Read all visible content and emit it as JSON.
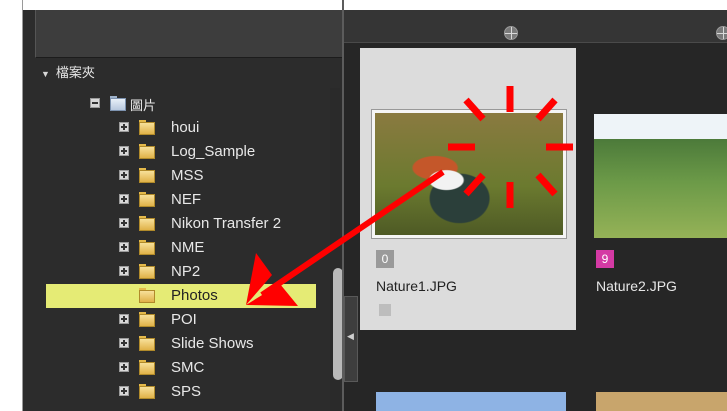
{
  "folder_panel": {
    "section_title": "檔案夾",
    "root_label": "圖片",
    "items": [
      {
        "label": "houi",
        "expander": "plus"
      },
      {
        "label": "Log_Sample",
        "expander": "plus"
      },
      {
        "label": "MSS",
        "expander": "plus"
      },
      {
        "label": "NEF",
        "expander": "plus"
      },
      {
        "label": "Nikon Transfer 2",
        "expander": "plus"
      },
      {
        "label": "NME",
        "expander": "plus"
      },
      {
        "label": "NP2",
        "expander": "plus"
      },
      {
        "label": "Photos",
        "expander": "none",
        "selected": true
      },
      {
        "label": "POI",
        "expander": "plus"
      },
      {
        "label": "Slide Shows",
        "expander": "plus"
      },
      {
        "label": "SMC",
        "expander": "plus"
      },
      {
        "label": "SPS",
        "expander": "plus"
      }
    ]
  },
  "thumbnails": [
    {
      "filename": "Nature1.JPG",
      "badge": "0",
      "selected": true
    },
    {
      "filename": "Nature2.JPG",
      "badge": "9",
      "selected": false
    }
  ],
  "colors": {
    "selection_highlight": "#e5eb75",
    "annotation_red": "#ff0000",
    "panel_dark": "#2c2c2c"
  },
  "icons": {
    "folder": "folder-icon",
    "globe": "globe-icon",
    "annotation": "red-arrow"
  }
}
